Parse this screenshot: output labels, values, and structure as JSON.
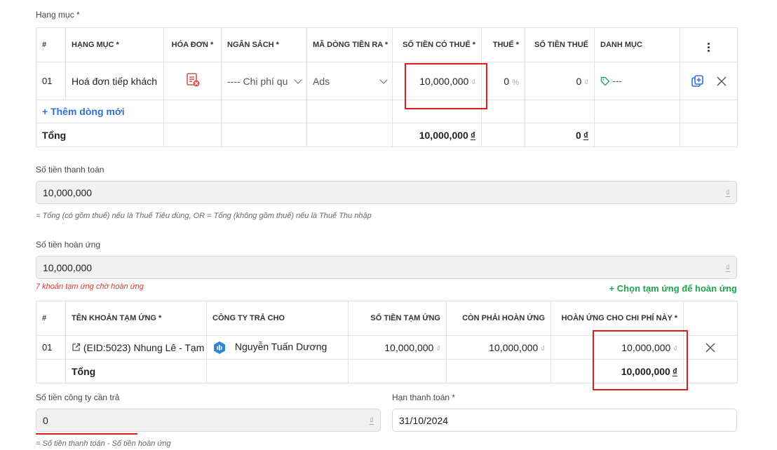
{
  "items_section": {
    "label": "Hạng mục *",
    "headers": [
      "#",
      "HẠNG MỤC *",
      "HÓA ĐƠN *",
      "NGÂN SÁCH *",
      "MÃ DÒNG TIỀN RA *",
      "SỐ TIỀN CÓ THUẾ *",
      "THUẾ *",
      "SỐ TIỀN THUẾ",
      "DANH MỤC"
    ],
    "row": {
      "index": "01",
      "name": "Hoá đơn tiếp khách",
      "budget": "---- Chi phí qu",
      "cashflow_code": "Ads",
      "amount": "10,000,000",
      "amount_unit": "₫",
      "tax": "0",
      "tax_unit": "%",
      "tax_amount": "0",
      "tax_amount_unit": "₫",
      "category": "---"
    },
    "add_row_label": "+ Thêm dòng mới",
    "total_label": "Tổng",
    "total_amount": "10,000,000",
    "total_tax": "0",
    "currency": "₫"
  },
  "payment": {
    "label": "Số tiền thanh toán",
    "value": "10,000,000",
    "unit": "₫",
    "note": "= Tổng (có gồm thuế) nếu là Thuế Tiêu dùng, OR = Tổng (không gồm thuế) nếu là Thuế Thu nhập"
  },
  "refund": {
    "label": "Số tiền hoàn ứng",
    "value": "10,000,000",
    "unit": "₫",
    "pending_note": "7 khoản tạm ứng chờ hoàn ứng",
    "choose_label": "+ Chọn tạm ứng để hoàn ứng"
  },
  "advance_table": {
    "headers": [
      "#",
      "TÊN KHOẢN TẠM ỨNG *",
      "CÔNG TY TRẢ CHO",
      "SỐ TIỀN TẠM ỨNG",
      "CÒN PHẢI HOÀN ỨNG",
      "HOÀN ỨNG CHO CHI PHÍ NÀY *"
    ],
    "row": {
      "index": "01",
      "name": "(EID:5023) Nhung Lê - Tạm",
      "payee": "Nguyễn Tuấn Dương",
      "advance_amount": "10,000,000",
      "remaining": "10,000,000",
      "refund_for_expense": "10,000,000",
      "unit": "₫"
    },
    "total_label": "Tổng",
    "total_refund": "10,000,000",
    "currency": "₫"
  },
  "company_pay": {
    "label": "Số tiền công ty cần trả",
    "value": "0",
    "unit": "₫",
    "note": "= Số tiền thanh toán - Số tiền hoàn ứng"
  },
  "due_date": {
    "label": "Hạn thanh toán *",
    "value": "31/10/2024"
  },
  "colors": {
    "highlight_red": "#e01b1b",
    "link_blue": "#2f6fd6",
    "link_green": "#1fa44f",
    "note_red": "#d9362b"
  }
}
